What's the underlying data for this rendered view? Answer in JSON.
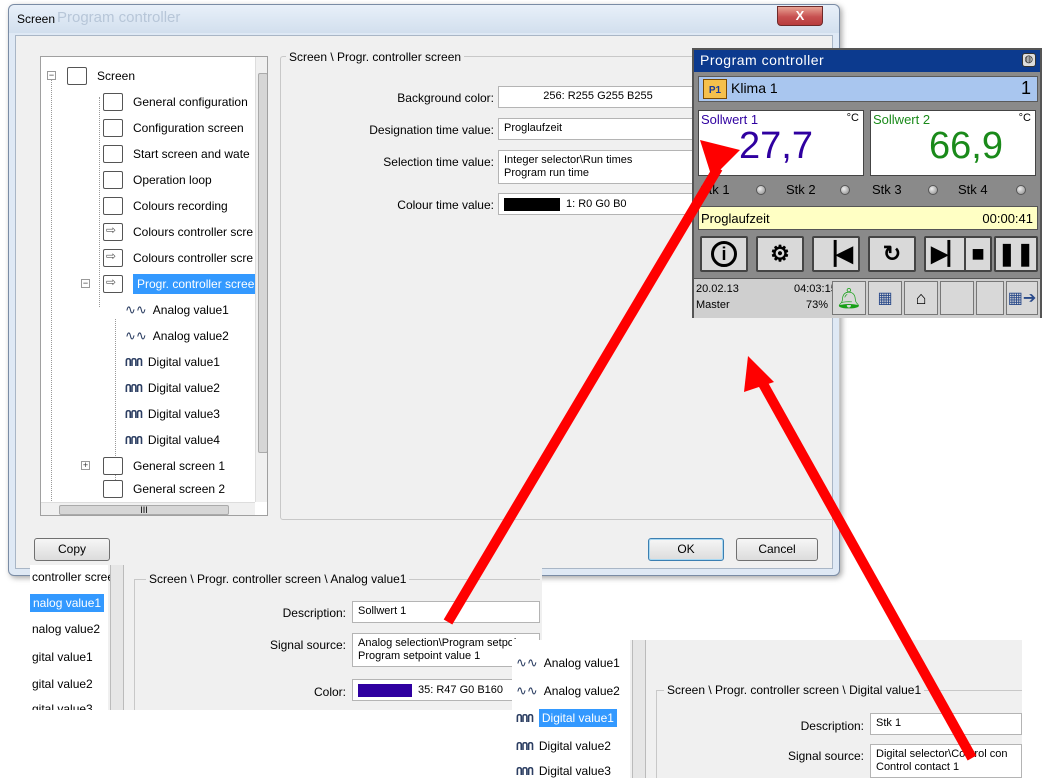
{
  "dialog": {
    "title": "Screen",
    "ghost_title": "Program controller",
    "close_glyph": "X",
    "tree": {
      "root": "Screen",
      "items": [
        "General configuration",
        "Configuration screen",
        "Start screen and wate",
        "Operation loop",
        "Colours recording",
        "Colours controller scre",
        "Colours controller scre",
        "Progr. controller scree"
      ],
      "children": [
        "Analog value1",
        "Analog value2",
        "Digital value1",
        "Digital value2",
        "Digital value3",
        "Digital value4"
      ],
      "after": [
        "General screen 1",
        "General screen 2"
      ],
      "hscroll_grip": "III"
    },
    "panel": {
      "legend": "Screen \\ Progr. controller screen",
      "background_label": "Background color:",
      "background_value": "256: R255 G255 B255",
      "designation_label": "Designation time value:",
      "designation_value": "Proglaufzeit",
      "selection_label": "Selection time value:",
      "selection_value_line1": "Integer selector\\Run times",
      "selection_value_line2": "Program run time",
      "colour_label": "Colour time value:",
      "colour_value": "1: R0 G0 B0",
      "colour_swatch": "#000000"
    },
    "buttons": {
      "copy": "Copy",
      "ok": "OK",
      "cancel": "Cancel"
    }
  },
  "device": {
    "title": "Program controller",
    "badge": "P1",
    "program_name": "Klima 1",
    "program_number": "1",
    "value1": {
      "label": "Sollwert 1",
      "unit": "°C",
      "value": "27,7",
      "color": "#2f00a0"
    },
    "value2": {
      "label": "Sollwert 2",
      "unit": "°C",
      "value": "66,9",
      "color": "#1a8a1a"
    },
    "contacts": [
      "Stk 1",
      "Stk 2",
      "Stk 3",
      "Stk 4"
    ],
    "time_label": "Proglaufzeit",
    "time_value": "00:00:41",
    "footer": {
      "date": "20.02.13",
      "time": "04:03:15",
      "user": "Master",
      "percent": "73%"
    }
  },
  "crop_analog": {
    "tree_items": [
      "controller scree",
      "nalog value1",
      "nalog value2",
      "gital value1",
      "gital value2",
      "gital value3"
    ],
    "legend": "Screen \\ Progr. controller screen \\ Analog value1",
    "description_label": "Description:",
    "description_value": "Sollwert 1",
    "signal_label": "Signal source:",
    "signal_line1": "Analog selection\\Program setpoi",
    "signal_line2": "Program setpoint value 1",
    "color_label": "Color:",
    "color_value": "35: R47 G0 B160",
    "color_swatch": "#2f00a0"
  },
  "crop_digital": {
    "tree_items": [
      "Analog value1",
      "Analog value2",
      "Digital value1",
      "Digital value2",
      "Digital value3"
    ],
    "legend": "Screen \\ Progr. controller screen \\ Digital value1",
    "description_label": "Description:",
    "description_value": "Stk 1",
    "signal_label": "Signal source:",
    "signal_line1": "Digital selector\\Control con",
    "signal_line2": "Control contact 1"
  },
  "colors": {
    "arrow": "#ff0000",
    "accent": "#3399ff"
  }
}
